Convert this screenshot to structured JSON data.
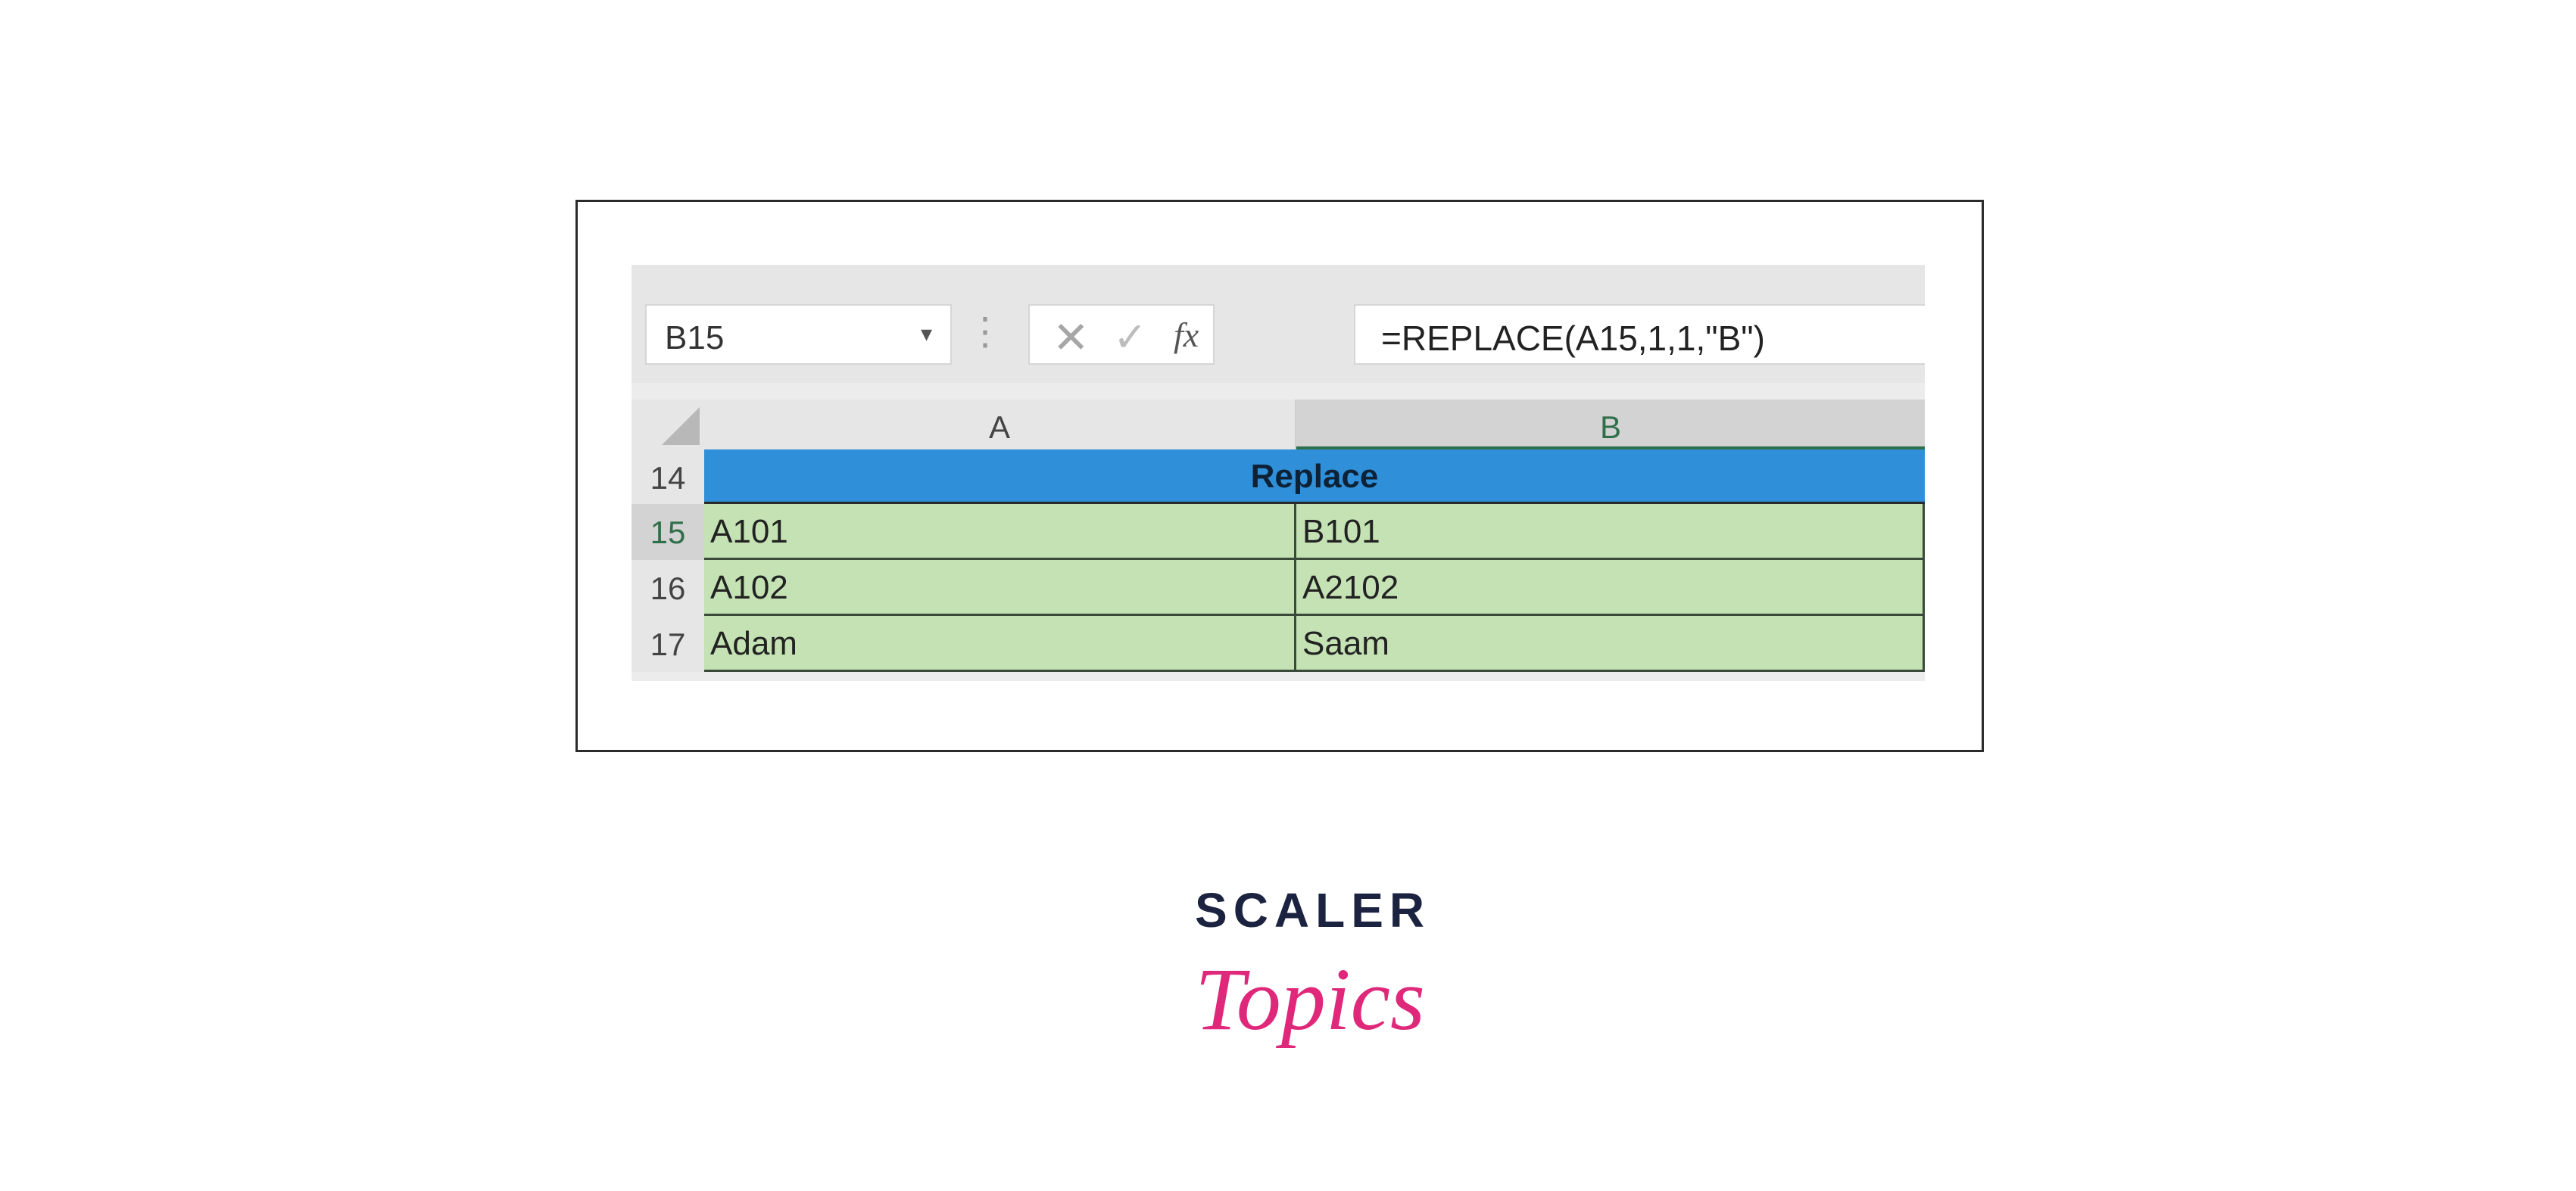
{
  "formula_bar": {
    "name_box": "B15",
    "name_box_arrow_icon": "chevron-down-icon",
    "cancel_icon": "close-icon",
    "enter_icon": "check-icon",
    "fx_label": "fx",
    "formula": "=REPLACE(A15,1,1,\"B\")"
  },
  "columns": [
    "A",
    "B"
  ],
  "header_row": {
    "row_number": "14",
    "label": "Replace"
  },
  "rows": [
    {
      "row_number": "15",
      "a": "A101",
      "b": "B101"
    },
    {
      "row_number": "16",
      "a": "A102",
      "b": "A2102"
    },
    {
      "row_number": "17",
      "a": "Adam",
      "b": "Saam"
    }
  ],
  "logo": {
    "top": "SCALER",
    "script": "Topics"
  },
  "colors": {
    "header_fill": "#2f8fd8",
    "cell_fill": "#c4e2b4",
    "logo_navy": "#1b2340",
    "logo_pink": "#e0287a"
  }
}
